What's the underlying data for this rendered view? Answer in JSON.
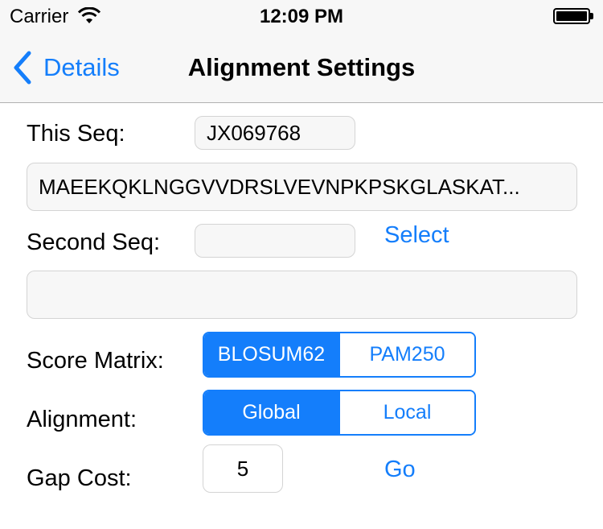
{
  "status_bar": {
    "carrier": "Carrier",
    "time": "12:09 PM",
    "icons": [
      "wifi-icon",
      "battery-icon"
    ]
  },
  "nav": {
    "back_label": "Details",
    "title": "Alignment Settings"
  },
  "form": {
    "this_seq_label": "This Seq:",
    "this_seq_id": "JX069768",
    "this_seq_sequence": "MAEEKQKLNGGVVDRSLVEVNPKPSKGLASKAT...",
    "second_seq_label": "Second Seq:",
    "second_seq_id": "",
    "select_label": "Select",
    "second_seq_sequence": "",
    "score_matrix_label": "Score Matrix:",
    "score_matrix_options": [
      "BLOSUM62",
      "PAM250"
    ],
    "score_matrix_selected": "BLOSUM62",
    "alignment_label": "Alignment:",
    "alignment_options": [
      "Global",
      "Local"
    ],
    "alignment_selected": "Global",
    "gap_cost_label": "Gap Cost:",
    "gap_cost_value": "5",
    "go_label": "Go"
  },
  "colors": {
    "accent": "#147efb",
    "bar_background": "#f7f7f7",
    "field_border": "#d4d4d4"
  }
}
